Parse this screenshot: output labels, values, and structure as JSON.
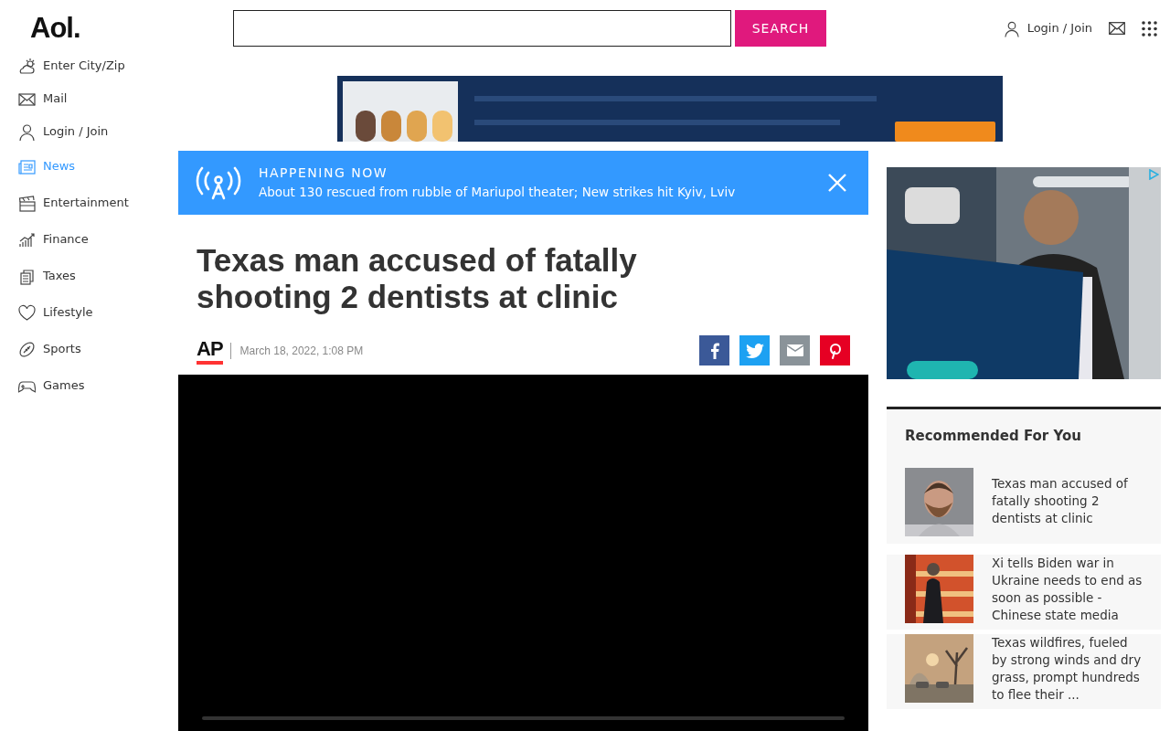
{
  "logo": "Aol.",
  "search": {
    "button": "SEARCH"
  },
  "account": {
    "login": "Login / Join"
  },
  "sidebar": {
    "items": [
      {
        "label": "Enter City/Zip",
        "selected": false
      },
      {
        "label": "Mail",
        "selected": false
      },
      {
        "label": "Login / Join",
        "selected": false
      },
      {
        "label": "News",
        "selected": true
      },
      {
        "label": "Entertainment",
        "selected": false
      },
      {
        "label": "Finance",
        "selected": false
      },
      {
        "label": "Taxes",
        "selected": false
      },
      {
        "label": "Lifestyle",
        "selected": false
      },
      {
        "label": "Sports",
        "selected": false
      },
      {
        "label": "Games",
        "selected": false
      }
    ]
  },
  "breaking": {
    "label": "HAPPENING NOW",
    "text": "About 130 rescued from rubble of Mariupol theater; New strikes hit Kyiv, Lviv"
  },
  "article": {
    "title": "Texas man accused of fatally shooting 2 dentists at clinic",
    "source": "AP",
    "date": "March 18, 2022, 1:08 PM"
  },
  "video": {
    "level": 0
  },
  "recommended": {
    "title": "Recommended For You",
    "items": [
      {
        "text": "Texas man accused of fatally shooting 2 dentists at clinic"
      },
      {
        "text": "Xi tells Biden war in Ukraine needs to end as soon as possible - Chinese state media"
      },
      {
        "text": "Texas wildfires, fueled by strong winds and dry grass, prompt hundreds to flee their ..."
      }
    ]
  }
}
